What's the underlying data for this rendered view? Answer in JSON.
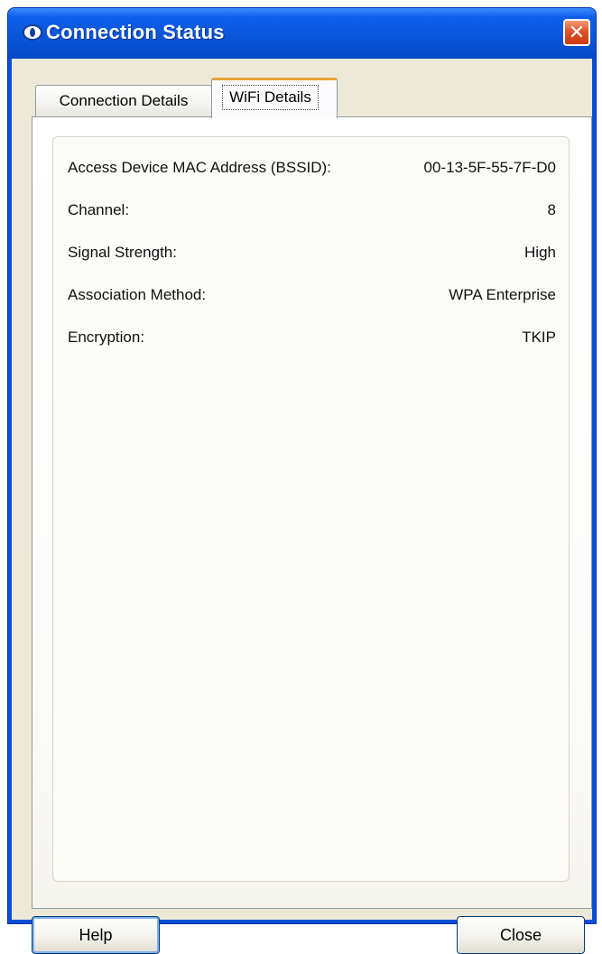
{
  "window": {
    "title": "Connection Status",
    "close_glyph": "✕"
  },
  "tabs": [
    {
      "label": "Connection Details",
      "selected": false
    },
    {
      "label": "WiFi Details",
      "selected": true
    }
  ],
  "details": [
    {
      "label": "Access Device MAC Address (BSSID):",
      "value": "00-13-5F-55-7F-D0"
    },
    {
      "label": "Channel:",
      "value": "8"
    },
    {
      "label": "Signal Strength:",
      "value": "High"
    },
    {
      "label": "Association Method:",
      "value": "WPA Enterprise"
    },
    {
      "label": "Encryption:",
      "value": "TKIP"
    }
  ],
  "buttons": {
    "help": "Help",
    "close": "Close"
  },
  "icons": {
    "app": "network-globe-icon",
    "close": "close-icon"
  },
  "colors": {
    "titlebar": "#0a55d8",
    "dialog_bg": "#ece9d8",
    "close_button": "#e0542b",
    "selected_tab_accent": "#e6a33a"
  }
}
